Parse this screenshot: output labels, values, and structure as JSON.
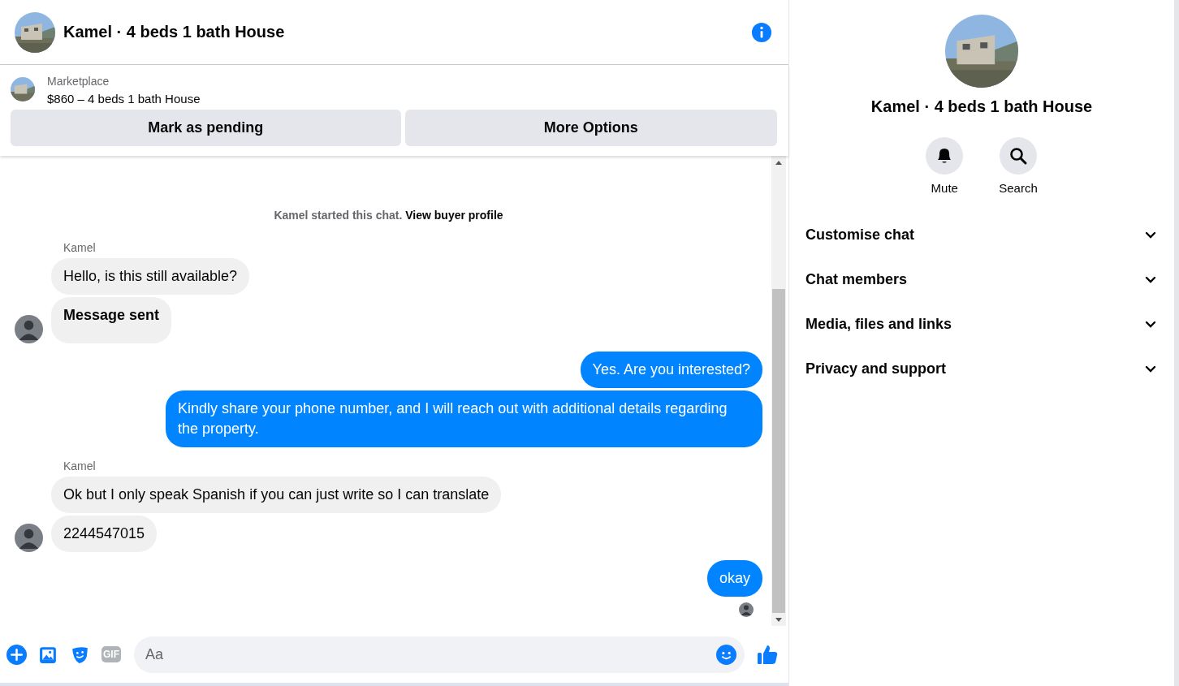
{
  "header": {
    "title": "Kamel · 4 beds 1 bath House"
  },
  "listing": {
    "source": "Marketplace",
    "summary": "$860 – 4 beds 1 bath House",
    "buttons": [
      "Mark as pending",
      "More Options"
    ]
  },
  "notice": {
    "text": "Kamel started this chat.",
    "link": "View buyer profile"
  },
  "groups": [
    {
      "kind": "incoming",
      "sender": "Kamel",
      "messages": [
        {
          "text": "Hello, is this still available?",
          "bold": false
        },
        {
          "text": "Message sent",
          "bold": true
        }
      ]
    },
    {
      "kind": "outgoing",
      "messages": [
        {
          "text": "Yes. Are you interested?",
          "bold": false
        },
        {
          "text": "Kindly share your phone number, and I will reach out with additional details regarding the property.",
          "bold": false
        }
      ]
    },
    {
      "kind": "incoming",
      "sender": "Kamel",
      "messages": [
        {
          "text": "Ok but I only speak Spanish if you can just write so I can translate",
          "bold": false
        },
        {
          "text": "2244547015",
          "bold": false
        }
      ]
    },
    {
      "kind": "outgoing",
      "seen": true,
      "messages": [
        {
          "text": "okay",
          "bold": false
        }
      ]
    }
  ],
  "composer": {
    "gif_label": "GIF",
    "placeholder": "Aa"
  },
  "profile": {
    "name": "Kamel · 4 beds 1 bath House",
    "actions": [
      {
        "kind": "mute",
        "label": "Mute"
      },
      {
        "kind": "search",
        "label": "Search"
      }
    ],
    "sections": [
      {
        "label": "Customise chat",
        "expanded": false
      },
      {
        "label": "Chat members",
        "expanded": false
      },
      {
        "label": "Media, files and links",
        "expanded": false
      },
      {
        "label": "Privacy and support",
        "expanded": false
      }
    ]
  }
}
